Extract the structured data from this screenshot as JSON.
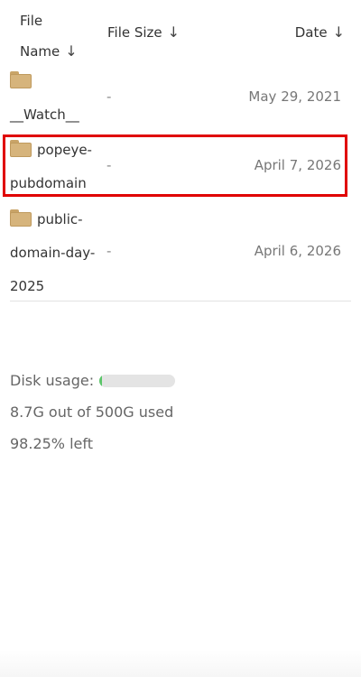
{
  "table": {
    "headers": {
      "name_line1": "File",
      "name_line2": "Name",
      "name_arrow": "↓",
      "size": "File Size",
      "size_arrow": "↓",
      "date": "Date",
      "date_arrow": "↓"
    },
    "rows": [
      {
        "name": "__Watch__",
        "size": "-",
        "date": "May 29, 2021",
        "icon": "folder-icon"
      },
      {
        "name": "popeye-pubdomain",
        "name_line1": "popeye-",
        "name_line2": "pubdomain",
        "size": "-",
        "date": "April 7, 2026",
        "icon": "folder-icon",
        "highlighted": true
      },
      {
        "name": "public-domain-day-2025",
        "name_line1": "public-",
        "name_line2": "domain-day-",
        "name_line3": "2025",
        "size": "-",
        "date": "April 6, 2026",
        "icon": "folder-icon"
      }
    ]
  },
  "disk": {
    "label": "Disk usage:",
    "used_text": "8.7G out of 500G used",
    "left_text": "98.25% left",
    "used_fraction": 0.0175
  },
  "colors": {
    "highlight": "#e00000",
    "folder": "#d6b47c",
    "usage_fill": "#5cc66a"
  }
}
